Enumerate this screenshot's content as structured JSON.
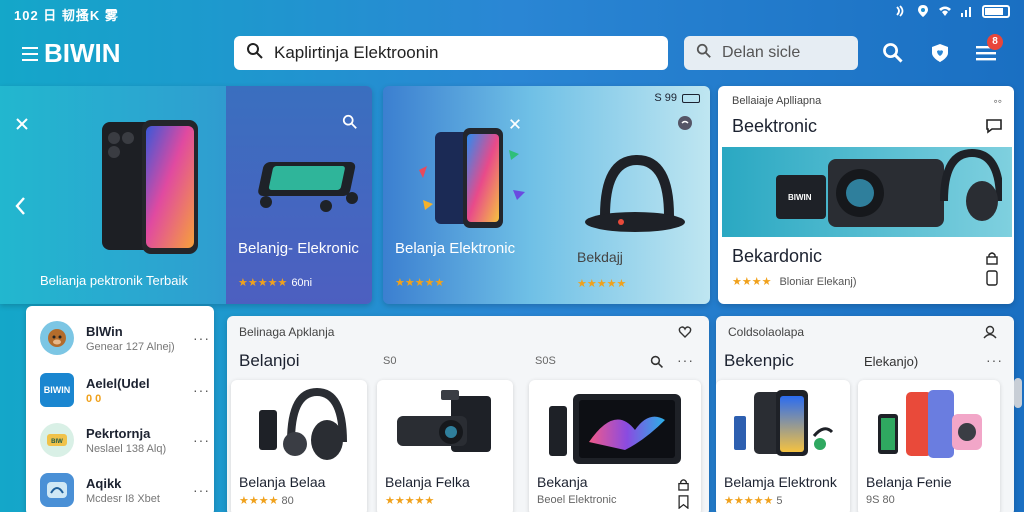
{
  "status": {
    "time": "102 日 韧搔K 雾"
  },
  "app": {
    "brand": "BIWIN"
  },
  "search": {
    "main_value": "Kaplirtinja Elektroonin",
    "secondary_value": "Delan sicle",
    "notif_count": "8"
  },
  "hero1": {
    "left_caption": "Belianja pektronik Terbaik",
    "right_title": "Belanjg- Elekronic",
    "rating_text": "60ni"
  },
  "hero2": {
    "status_text": "S 99",
    "title": "Belanja Elektronic",
    "product_title": "Bekdajj"
  },
  "hero3": {
    "subtitle": "Bellaiaje Aplliapna",
    "title": "Beektronic",
    "banner_brand": "BIWIN",
    "product_name": "Bekardonic",
    "product_sub": "Bloniar Elekanj)"
  },
  "sidebar": {
    "items": [
      {
        "name": "BlWin",
        "sub": "Genear 127 Alnej)",
        "icon": "avatar-monkey"
      },
      {
        "name": "Aelel(Udel",
        "sub": "0 0",
        "icon": "brand-logo"
      },
      {
        "name": "Pekrtornja",
        "sub": "Neslael 138 Alq)",
        "icon": "brand-logo"
      },
      {
        "name": "Aqikk",
        "sub": "Mcdesr I8 Xbet",
        "icon": "app-icon"
      }
    ]
  },
  "mid_section": {
    "subtitle": "Belinaga Apklanja",
    "heading": "Belanjoi",
    "meta_a": "S0",
    "meta_b": "S0S",
    "products": [
      {
        "name": "Belanja Belaa",
        "rating_value": "80",
        "icon": "camera-headphone"
      },
      {
        "name": "Belanja Felka",
        "rating_value": "",
        "icon": "speaker"
      },
      {
        "name": "Bekanja",
        "rating_value": "Beoel Elektronic",
        "icon": "tablet"
      }
    ]
  },
  "right_section": {
    "subtitle": "Coldsolaolapa",
    "heading": "Bekenpic",
    "meta": "Elekanjo)",
    "products": [
      {
        "name": "Belamja Elektronk",
        "rating_value": "5",
        "icon": "phones"
      },
      {
        "name": "Belanja Fenie",
        "rating_value": "9S 80",
        "icon": "phones-camera"
      }
    ]
  },
  "colors": {
    "accent": "#2a86d4",
    "star": "#f0a11c",
    "badge": "#e8463a"
  }
}
